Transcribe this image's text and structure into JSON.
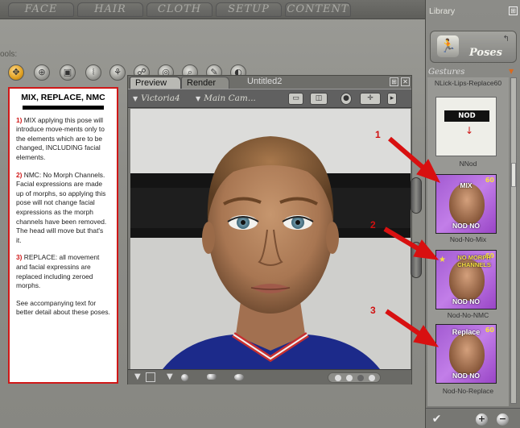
{
  "top_tabs": [
    "FACE",
    "HAIR",
    "CLOTH",
    "SETUP",
    "CONTENT"
  ],
  "tools_label": "ools:",
  "tools": [
    {
      "icon": "move-icon",
      "active": true
    },
    {
      "icon": "translate-icon"
    },
    {
      "icon": "scale-icon"
    },
    {
      "icon": "taper-icon"
    },
    {
      "icon": "twist-icon"
    },
    {
      "icon": "chain-icon"
    },
    {
      "icon": "target-icon"
    },
    {
      "icon": "zoom-icon"
    },
    {
      "icon": "morph-brush-icon"
    },
    {
      "icon": "color-icon"
    }
  ],
  "note": {
    "title": "MIX, REPLACE, NMC",
    "items": [
      {
        "num": "1)",
        "text": " MIX applying this pose will introduce move-ments only to the elements which are to be changed, INCLUDING facial elements."
      },
      {
        "num": "2)",
        "text": " NMC: No Morph Channels. Facial expressions are made up of morphs, so applying this pose will not change facial expressions as the morph channels have been removed. The head will move but that's it."
      },
      {
        "num": "3)",
        "text": " REPLACE: all movement and facial expressins are replaced including zeroed morphs."
      },
      {
        "num": "",
        "text": "See accompanying text for better detail about these poses."
      }
    ]
  },
  "doc_window": {
    "tabs": [
      "Preview",
      "Render"
    ],
    "title": "Untitled2",
    "figure_select": "Victoria4",
    "camera_select": "Main Cam..."
  },
  "library": {
    "title": "Library",
    "category": "Poses",
    "subcategory": "Gestures",
    "items": [
      {
        "label": "NLick-Lips-Replace60",
        "thumb_text_top": "",
        "thumb_text_bottom": ""
      },
      {
        "label": "NNod",
        "thumb_text_top": "NOD",
        "thumb_text_bottom": ""
      },
      {
        "label": "Nod-No-Mix",
        "thumb_text_top": "MIX",
        "thumb_text_bottom": "NOD NO",
        "badge": "60"
      },
      {
        "label": "Nod-No-NMC",
        "thumb_text_top": "NO MORPH CHANNELS",
        "thumb_text_bottom": "NOD NO",
        "badge": "60"
      },
      {
        "label": "Nod-No-Replace",
        "thumb_text_top": "Replace",
        "thumb_text_bottom": "NOD NO",
        "badge": "60"
      }
    ]
  },
  "callouts": [
    "1",
    "2",
    "3"
  ],
  "colors": {
    "accent_red": "#d01818",
    "thumb_purple": "#b26ee0"
  }
}
